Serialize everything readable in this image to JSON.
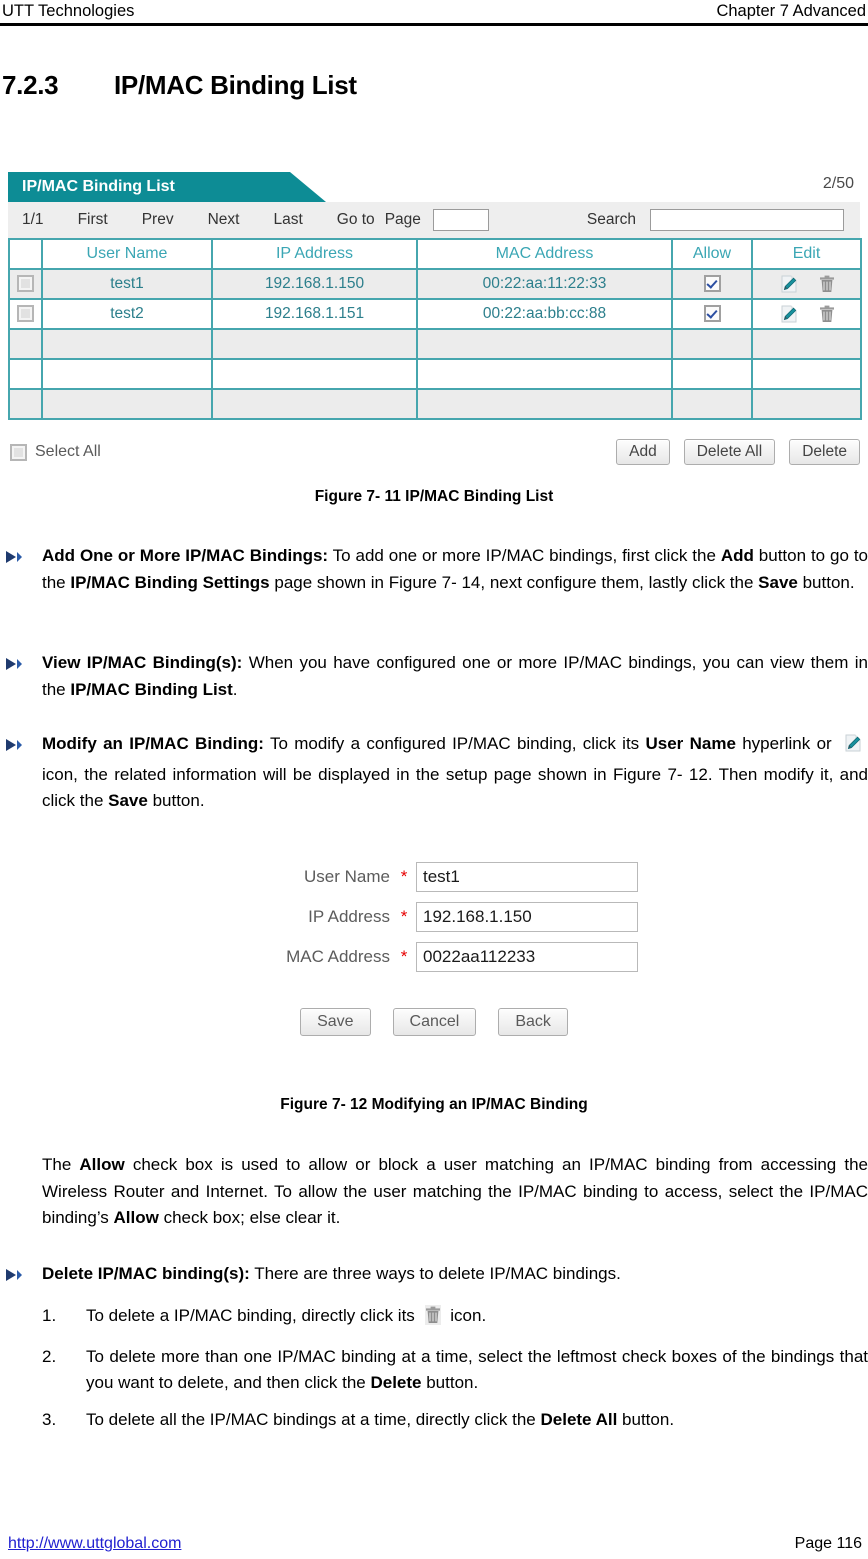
{
  "header": {
    "left": "UTT Technologies",
    "right": "Chapter 7 Advanced"
  },
  "heading": {
    "number": "7.2.3",
    "title": "IP/MAC Binding List"
  },
  "screenshot_list": {
    "tab_label": "IP/MAC Binding List",
    "count": "2/50",
    "toolbar": {
      "page_indicator": "1/1",
      "first": "First",
      "prev": "Prev",
      "next": "Next",
      "last": "Last",
      "goto": "Go to",
      "page_label": "Page",
      "page_input_value": "",
      "search_label": "Search",
      "search_input_value": ""
    },
    "columns": [
      "",
      "User Name",
      "IP Address",
      "MAC Address",
      "Allow",
      "Edit"
    ],
    "rows": [
      {
        "selected": false,
        "user_name": "test1",
        "ip_address": "192.168.1.150",
        "mac_address": "00:22:aa:11:22:33",
        "allow": true
      },
      {
        "selected": false,
        "user_name": "test2",
        "ip_address": "192.168.1.151",
        "mac_address": "00:22:aa:bb:cc:88",
        "allow": true
      },
      {
        "empty": true
      },
      {
        "empty": true
      },
      {
        "empty": true
      }
    ],
    "select_all_label": "Select All",
    "buttons": {
      "add": "Add",
      "delete_all": "Delete All",
      "delete": "Delete"
    },
    "accent_teal": "#0d8c95",
    "grid_teal": "#46a6ae"
  },
  "figure_11_caption": "Figure 7- 11 IP/MAC Binding List",
  "bullets": {
    "add": {
      "title": "Add One or More IP/MAC Bindings:",
      "t1": " To add one or more IP/MAC bindings, first click the ",
      "b1": "Add",
      "t2": " button to go to the ",
      "b2": "IP/MAC Binding Settings",
      "t3": " page shown in Figure 7- 14, next configure them, lastly click the ",
      "b3": "Save",
      "t4": " button."
    },
    "view": {
      "title": "View IP/MAC Binding(s):",
      "t1": " When you have configured one or more IP/MAC bindings, you can view them in the ",
      "b1": "IP/MAC Binding List",
      "t2": "."
    },
    "modify": {
      "title": "Modify an IP/MAC Binding:",
      "t1": " To modify a configured IP/MAC binding, click its ",
      "b1": "User Name",
      "t2": " hyperlink or ",
      "t3": " icon, the related information will be displayed in the setup page shown in Figure 7- 12. Then modify it, and click the ",
      "b2": "Save",
      "t4": " button."
    },
    "delete": {
      "title": "Delete IP/MAC binding(s):",
      "t1": " There are three ways to delete IP/MAC bindings."
    }
  },
  "screenshot_form": {
    "fields": [
      {
        "label": "User Name",
        "required": "*",
        "value": "test1"
      },
      {
        "label": "IP Address",
        "required": "*",
        "value": "192.168.1.150"
      },
      {
        "label": "MAC Address",
        "required": "*",
        "value": "0022aa112233"
      }
    ],
    "buttons": {
      "save": "Save",
      "cancel": "Cancel",
      "back": "Back"
    }
  },
  "figure_12_caption": "Figure 7- 12 Modifying an IP/MAC Binding",
  "allow_paragraph": {
    "t1": "The ",
    "b1": "Allow",
    "t2": " check box is used to allow or block a user matching an IP/MAC binding from accessing the Wireless Router and Internet. To allow the user matching the IP/MAC binding to access, select the IP/MAC binding’s ",
    "b2": "Allow",
    "t3": " check box; else clear it."
  },
  "delete_steps": [
    {
      "num": "1.",
      "t1": "To delete a IP/MAC binding, directly click its ",
      "t2": " icon."
    },
    {
      "num": "2.",
      "t1": "To delete more than one IP/MAC binding at a time, select the leftmost check boxes of the bindings that you want to delete, and then click the ",
      "b1": "Delete",
      "t2": " button."
    },
    {
      "num": "3.",
      "t1": "To delete all the IP/MAC bindings at a time, directly click the ",
      "b1": "Delete All",
      "t2": " button."
    }
  ],
  "footer": {
    "link": "http://www.uttglobal.com",
    "page": "Page 116"
  }
}
